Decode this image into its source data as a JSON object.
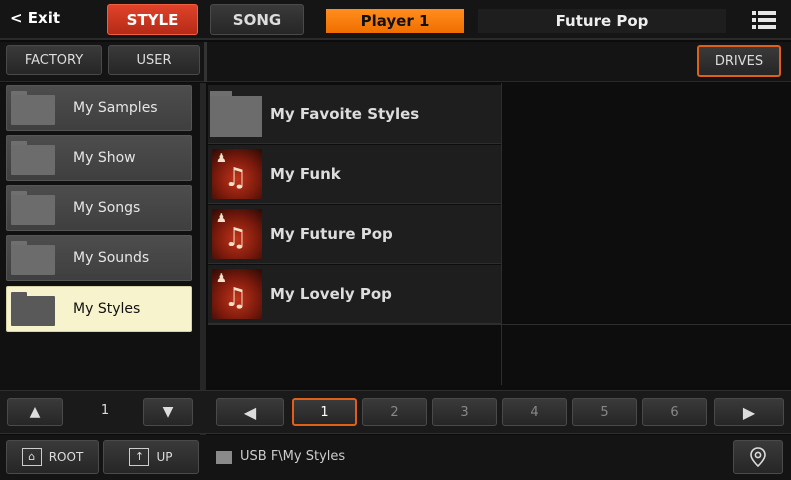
{
  "top": {
    "exit": "< Exit",
    "style": "STYLE",
    "song": "SONG",
    "player": "Player 1",
    "current_style": "Future Pop",
    "menu_icon": "menu-icon"
  },
  "tabs": {
    "factory": "FACTORY",
    "user": "USER",
    "drives": "DRIVES"
  },
  "folders": [
    {
      "label": "My Samples"
    },
    {
      "label": "My Show"
    },
    {
      "label": "My Songs"
    },
    {
      "label": "My Sounds"
    },
    {
      "label": "My Styles"
    }
  ],
  "list": [
    {
      "label": "My Favoite Styles",
      "icon": "folder-icon"
    },
    {
      "label": "My Funk",
      "icon": "style-icon"
    },
    {
      "label": "My Future Pop",
      "icon": "style-icon"
    },
    {
      "label": "My Lovely Pop",
      "icon": "style-icon"
    }
  ],
  "left_nav": {
    "page": "1"
  },
  "pages": [
    "1",
    "2",
    "3",
    "4",
    "5",
    "6"
  ],
  "bottom": {
    "root": "ROOT",
    "up": "UP",
    "path": "USB F\\My Styles"
  },
  "colors": {
    "accent_red": "#d63a22",
    "accent_orange": "#ff8a1a",
    "selected": "#f6f3cd"
  }
}
